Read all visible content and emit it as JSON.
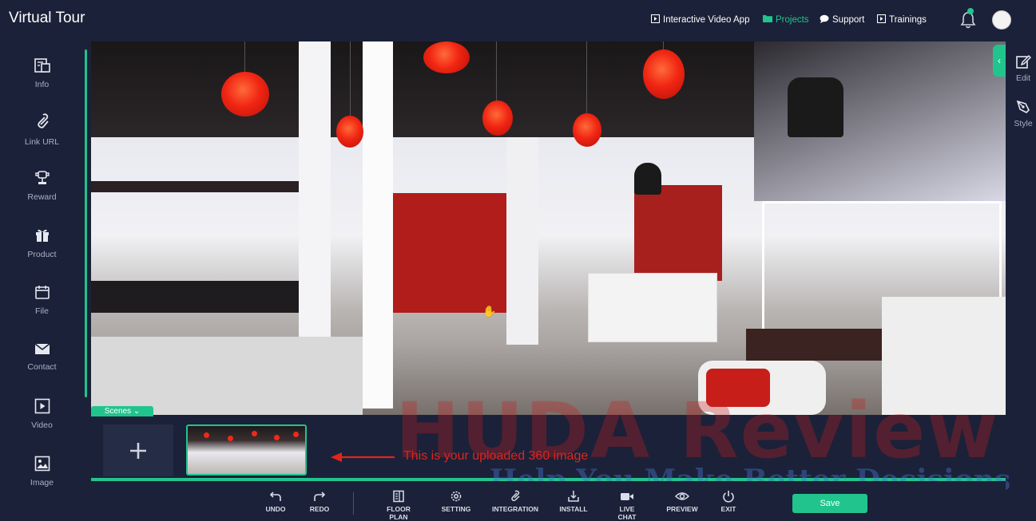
{
  "header": {
    "app_title": "Virtual Tour",
    "nav": [
      {
        "label": "Interactive Video App",
        "icon": "play-square-icon",
        "active": false
      },
      {
        "label": "Projects",
        "icon": "folder-icon",
        "active": true
      },
      {
        "label": "Support",
        "icon": "chat-bubble-icon",
        "active": false
      },
      {
        "label": "Trainings",
        "icon": "play-square-icon",
        "active": false
      }
    ]
  },
  "left_tools": [
    {
      "label": "Info",
      "icon": "info-card-icon"
    },
    {
      "label": "Link URL",
      "icon": "paperclip-icon"
    },
    {
      "label": "Reward",
      "icon": "reward-icon"
    },
    {
      "label": "Product",
      "icon": "gift-icon"
    },
    {
      "label": "File",
      "icon": "calendar-icon"
    },
    {
      "label": "Contact",
      "icon": "envelope-icon"
    },
    {
      "label": "Video",
      "icon": "play-icon"
    },
    {
      "label": "Image",
      "icon": "image-icon"
    }
  ],
  "right_tools": [
    {
      "label": "Edit",
      "icon": "edit-icon"
    },
    {
      "label": "Style",
      "icon": "pen-nib-icon"
    }
  ],
  "scenes": {
    "tab_label": "Scenes",
    "add_icon": "plus-icon",
    "scroll_progress": 1.0
  },
  "annotation": {
    "text": "This is your uploaded 360 image"
  },
  "watermark": {
    "line1": "HUDA Review",
    "line2": "Help You Make Better Decisions"
  },
  "footer_tools": [
    {
      "label": "UNDO",
      "icon": "undo-icon"
    },
    {
      "label": "REDO",
      "icon": "redo-icon"
    },
    {
      "label": "FLOOR PLAN",
      "icon": "floor-plan-icon"
    },
    {
      "label": "SETTING",
      "icon": "gear-icon"
    },
    {
      "label": "INTEGRATION",
      "icon": "paperclip-icon"
    },
    {
      "label": "INSTALL",
      "icon": "install-icon"
    },
    {
      "label": "LIVE CHAT",
      "icon": "video-camera-icon"
    },
    {
      "label": "PREVIEW",
      "icon": "eye-icon"
    },
    {
      "label": "EXIT",
      "icon": "power-icon"
    }
  ],
  "save_label": "Save",
  "colors": {
    "accent": "#22c48d",
    "background": "#1b2138",
    "annotation": "#e0251c"
  }
}
